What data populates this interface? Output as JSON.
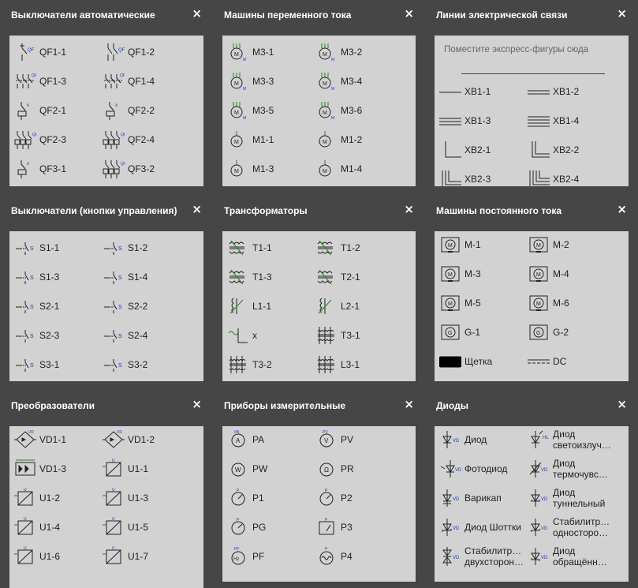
{
  "panels": [
    {
      "id": "breakers_auto",
      "title": "Выключатели автоматические",
      "hint": "",
      "items": [
        "QF1-1",
        "QF1-2",
        "QF1-3",
        "QF1-4",
        "QF2-1",
        "QF2-2",
        "QF2-3",
        "QF2-4",
        "QF3-1",
        "QF3-2"
      ],
      "icons": [
        "breaker-qf-icon",
        "breaker-qf-double-icon",
        "breaker-three-pole-icon",
        "breaker-three-pole-icon",
        "breaker-coil-icon",
        "breaker-coil-icon",
        "breaker-three-coil-icon",
        "breaker-three-coil-icon",
        "breaker-coil-icon",
        "breaker-three-coil-icon"
      ]
    },
    {
      "id": "ac_machines",
      "title": "Машины переменного тока",
      "hint": "",
      "items": [
        "M3-1",
        "M3-2",
        "M3-3",
        "M3-4",
        "M3-5",
        "M3-6",
        "M1-1",
        "M1-2",
        "M1-3",
        "M1-4"
      ],
      "icons": [
        "motor-three-phase-icon",
        "motor-three-phase-icon",
        "motor-three-phase-icon",
        "motor-three-phase-icon",
        "motor-three-phase-icon",
        "motor-three-phase-icon",
        "motor-single-phase-icon",
        "motor-single-phase-icon",
        "motor-single-phase-icon",
        "motor-single-phase-icon"
      ]
    },
    {
      "id": "lines",
      "title": "Линии электрической связи",
      "hint": "Поместите экспресс-фигуры сюда",
      "items": [
        "XB1-1",
        "XB1-2",
        "XB1-3",
        "XB1-4",
        "XB2-1",
        "XB2-2",
        "XB2-3",
        "XB2-4"
      ],
      "icons": [
        "line-single-icon",
        "line-double-icon",
        "line-triple-icon",
        "line-quad-icon",
        "line-corner-icon",
        "line-corner-double-icon",
        "line-corner-triple-icon",
        "line-corner-quad-icon"
      ]
    },
    {
      "id": "buttons",
      "title": "Выключатели (кнопки управления)",
      "hint": "",
      "items": [
        "S1-1",
        "S1-2",
        "S1-3",
        "S1-4",
        "S2-1",
        "S2-2",
        "S2-3",
        "S2-4",
        "S3-1",
        "S3-2"
      ],
      "icons": [
        "push-button-icon",
        "push-button-icon",
        "push-button-icon",
        "push-button-icon",
        "push-button-icon",
        "push-button-icon",
        "push-button-icon",
        "push-button-icon",
        "push-button-icon",
        "push-button-icon"
      ]
    },
    {
      "id": "transformers",
      "title": "Трансформаторы",
      "hint": "",
      "items": [
        "T1-1",
        "T1-2",
        "T1-3",
        "T2-1",
        "L1-1",
        "L2-1",
        "x",
        "T3-1",
        "T3-2",
        "L3-1"
      ],
      "icons": [
        "transformer-icon",
        "transformer-icon",
        "transformer-icon",
        "transformer-icon",
        "inductor-icon",
        "inductor-icon",
        "ac-corner-icon",
        "transformer-three-icon",
        "transformer-three-icon",
        "transformer-three-icon"
      ]
    },
    {
      "id": "dc_machines",
      "title": "Машины постоянного тока",
      "hint": "",
      "items": [
        "M-1",
        "M-2",
        "M-3",
        "M-4",
        "M-5",
        "M-6",
        "G-1",
        "G-2",
        "Щетка",
        "DC"
      ],
      "icons": [
        "dc-motor-icon",
        "dc-motor-icon",
        "dc-motor-icon",
        "dc-motor-icon",
        "dc-motor-icon",
        "dc-motor-icon",
        "dc-generator-icon",
        "dc-generator-icon",
        "brush-icon",
        "dc-line-icon"
      ]
    },
    {
      "id": "converters",
      "title": "Преобразователи",
      "hint": "",
      "items": [
        "VD1-1",
        "VD1-2",
        "VD1-3",
        "U1-1",
        "U1-2",
        "U1-3",
        "U1-4",
        "U1-5",
        "U1-6",
        "U1-7"
      ],
      "icons": [
        "diode-bridge-icon",
        "diode-bridge-icon",
        "rectifier-block-icon",
        "converter-icon",
        "converter-icon",
        "converter-icon",
        "converter-icon",
        "converter-icon",
        "converter-icon",
        "converter-icon"
      ]
    },
    {
      "id": "meters",
      "title": "Приборы измерительные",
      "hint": "",
      "items": [
        "PA",
        "PV",
        "PW",
        "PR",
        "P1",
        "P2",
        "PG",
        "P3",
        "PF",
        "P4"
      ],
      "icons": [
        "ammeter-icon",
        "voltmeter-icon",
        "wattmeter-icon",
        "ohmmeter-icon",
        "meter-icon",
        "meter-icon",
        "meter-icon",
        "meter-square-icon",
        "frequency-meter-icon",
        "oscilloscope-icon"
      ]
    },
    {
      "id": "diodes",
      "title": "Диоды",
      "hint": "",
      "items": [
        "Диод",
        "Диод светоизлуч…",
        "Фотодиод",
        "Диод термочувс…",
        "Варикап",
        "Диод туннельный",
        "Диод Шоттки",
        "Стабилитр… односторо…",
        "Стабилитр… двухсторон…",
        "Диод обращённ…"
      ],
      "icons": [
        "diode-icon",
        "led-icon",
        "photodiode-icon",
        "thermo-diode-icon",
        "varicap-icon",
        "tunnel-diode-icon",
        "schottky-diode-icon",
        "zener-diode-icon",
        "zener-bidirectional-icon",
        "backward-diode-icon"
      ]
    }
  ],
  "close_label": "×",
  "colors": {
    "background": "#5f5f5f",
    "panel": "#464646",
    "content": "#d2d2d2",
    "text": "#222222",
    "accent_blue": "#0a3fc9",
    "accent_green": "#1a8a1a"
  },
  "small_labels": {
    "QF": "QF",
    "S": "S",
    "VD": "VD",
    "U": "U",
    "HL": "HL",
    "A": "PA",
    "V": "PV"
  }
}
